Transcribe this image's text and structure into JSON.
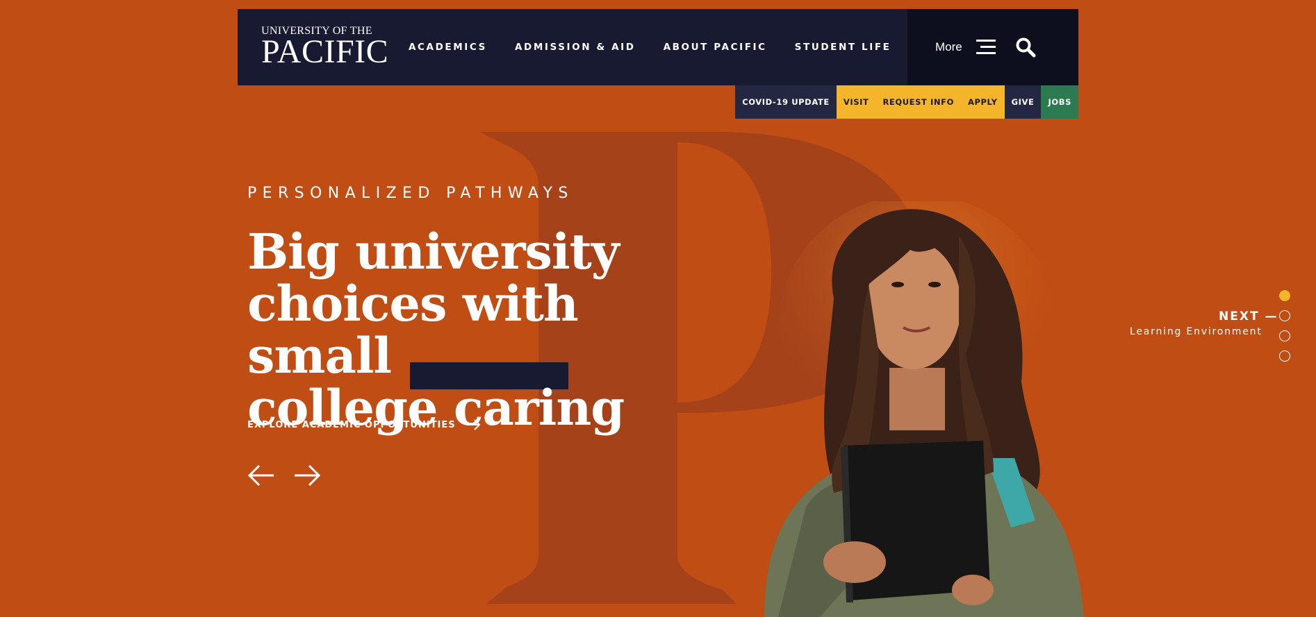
{
  "header": {
    "logo_top": "UNIVERSITY OF THE",
    "logo_main": "PACIFIC",
    "nav": [
      "ACADEMICS",
      "ADMISSION & AID",
      "ABOUT PACIFIC",
      "STUDENT LIFE"
    ],
    "more_label": "More"
  },
  "utility": {
    "covid": "COVID-19 UPDATE",
    "visit": "VISIT",
    "request_info": "REQUEST INFO",
    "apply": "APPLY",
    "give": "GIVE",
    "jobs": "JOBS"
  },
  "hero": {
    "eyebrow": "PERSONALIZED PATHWAYS",
    "headline_lines": [
      "Big university",
      "choices with small",
      "college caring"
    ],
    "cta": "EXPLORE ACADEMIC OPPORTUNITIES"
  },
  "slider": {
    "next_label": "NEXT —",
    "next_title": "Learning Environment",
    "active_dot_index": 0,
    "dot_count": 4
  },
  "colors": {
    "background": "#c04d14",
    "header": "#171a30",
    "accent_yellow": "#f5b52a",
    "jobs_green": "#2c7a50"
  }
}
